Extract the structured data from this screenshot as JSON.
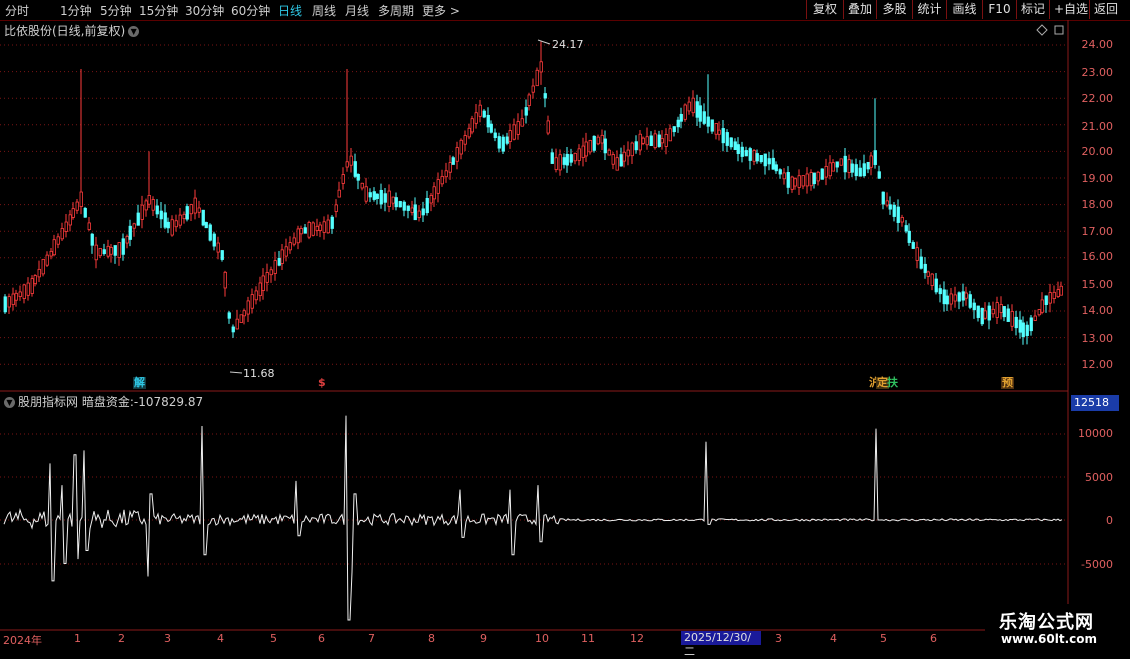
{
  "toolbar": {
    "periods": [
      "分时",
      "1分钟",
      "5分钟",
      "15分钟",
      "30分钟",
      "60分钟",
      "日线",
      "周线",
      "月线",
      "多周期",
      "更多"
    ],
    "active_period": "日线",
    "more_chevron": ">",
    "buttons": [
      "复权",
      "叠加",
      "多股",
      "统计",
      "画线",
      "F10",
      "标记",
      "+自选",
      "返回"
    ]
  },
  "stock": {
    "title": "比依股份(日线,前复权)",
    "high_label": "24.17",
    "low_label": "11.68"
  },
  "price_axis": [
    "24.00",
    "23.00",
    "22.00",
    "21.00",
    "20.00",
    "19.00",
    "18.00",
    "17.00",
    "16.00",
    "15.00",
    "14.00",
    "13.00",
    "12.00"
  ],
  "event_tags": [
    {
      "text": "解",
      "color": "#2ec8e6"
    },
    {
      "text": "$",
      "color": "#e04040"
    },
    {
      "text": "沪",
      "color": "#e0a030"
    },
    {
      "text": "定",
      "color": "#e0a030"
    },
    {
      "text": "扶",
      "color": "#30c060"
    },
    {
      "text": "预",
      "color": "#e0a030"
    }
  ],
  "indicator": {
    "source": "股朋指标网",
    "name": "暗盘资金:",
    "value": "-107829.87",
    "current_box": "12518",
    "axis": [
      "10000",
      "5000",
      "0",
      "-5000"
    ]
  },
  "date_axis": {
    "labels": [
      "2024年",
      "1",
      "2",
      "3",
      "4",
      "5",
      "6",
      "7",
      "8",
      "9",
      "10",
      "11",
      "12",
      "3",
      "4",
      "5",
      "6"
    ],
    "cursor": "2025/12/30/二"
  },
  "watermark": {
    "title": "乐淘公式网",
    "url": "www.60lt.com"
  },
  "colors": {
    "up": "#ff3c3c",
    "down": "#54ffff",
    "grid": "#8a1a1a",
    "accent": "#2ec8e6"
  }
}
